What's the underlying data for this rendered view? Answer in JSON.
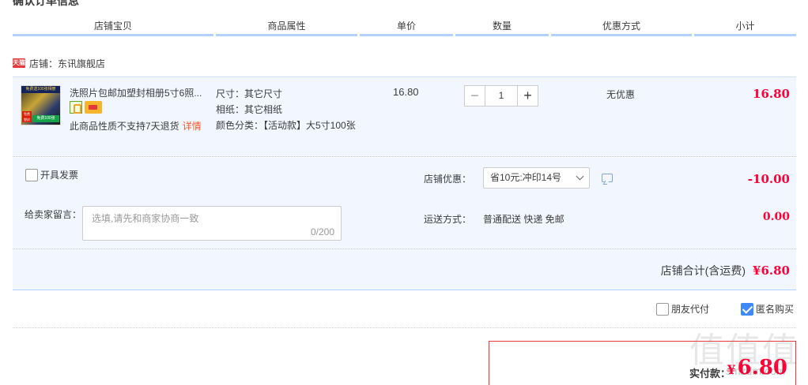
{
  "page": {
    "cut_title": "确认订单信息"
  },
  "columns": [
    "店铺宝贝",
    "商品属性",
    "单价",
    "数量",
    "优惠方式",
    "小计"
  ],
  "shop": {
    "badge": "天猫",
    "label": "店铺：东讯旗舰店"
  },
  "item": {
    "thumb_text_top": "免费送100张相册",
    "thumb_text_left": "免费 塑封",
    "thumb_text_bottom": "免费100张",
    "title": "洗照片包邮加塑封相册5寸6照...",
    "no_return": "此商品性质不支持7天退货",
    "detail_link": "详情",
    "attrs": [
      "尺寸：其它尺寸",
      "相纸：其它相纸",
      "颜色分类：【活动款】大5寸100张"
    ],
    "unit_price": "16.80",
    "quantity": "1",
    "minus": "−",
    "plus": "+",
    "discount": "无优惠",
    "subtotal": "16.80"
  },
  "order": {
    "invoice_label": "开具发票",
    "invoice_checked": false,
    "message_label": "给卖家留言：",
    "message_placeholder": "选填,请先和商家协商一致",
    "message_counter": "0/200",
    "shop_discount_label": "店铺优惠：",
    "coupon_selected": "省10元:冲印14号",
    "shop_discount_value": "-10.00",
    "shipping_label": "运送方式：",
    "shipping_value": "普通配送 快递 免邮",
    "shipping_fee": "0.00",
    "shop_total_label": "店铺合计(含运费)",
    "shop_total_value": "¥6.80"
  },
  "options": {
    "friend_pay_label": "朋友代付",
    "friend_pay_checked": false,
    "anonymous_label": "匿名购买",
    "anonymous_checked": true
  },
  "payment": {
    "paid_label": "实付款：",
    "currency": "¥",
    "amount": "6.80"
  },
  "watermark": {
    "chars": "值值值",
    "url": "smzdm.com"
  },
  "colors": {
    "accent_red": "#ff0036",
    "header_line": "#b2d1ff",
    "panel_bg": "#f2f7ff",
    "checkbox_blue": "#3d8af7"
  }
}
